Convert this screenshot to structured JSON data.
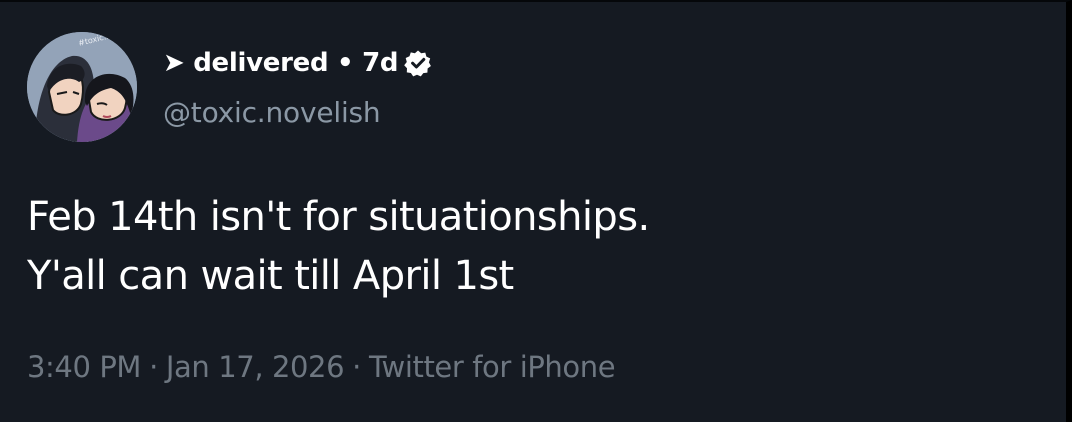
{
  "tweet": {
    "author": {
      "display_name": "➤ delivered • 7d",
      "handle": "@toxic.novelish",
      "verified": true,
      "avatar_watermark": "#toxic.novelish"
    },
    "text_lines": [
      "Feb 14th isn't for situationships.",
      "Y'all can wait till April 1st"
    ],
    "meta": {
      "time": "3:40 PM",
      "date": "Jan 17, 2026",
      "source": "Twitter for iPhone",
      "separator": "·"
    }
  },
  "colors": {
    "background": "#151a22",
    "text_primary": "#ffffff",
    "text_secondary": "#8b98a5",
    "text_meta": "#6e7781"
  }
}
